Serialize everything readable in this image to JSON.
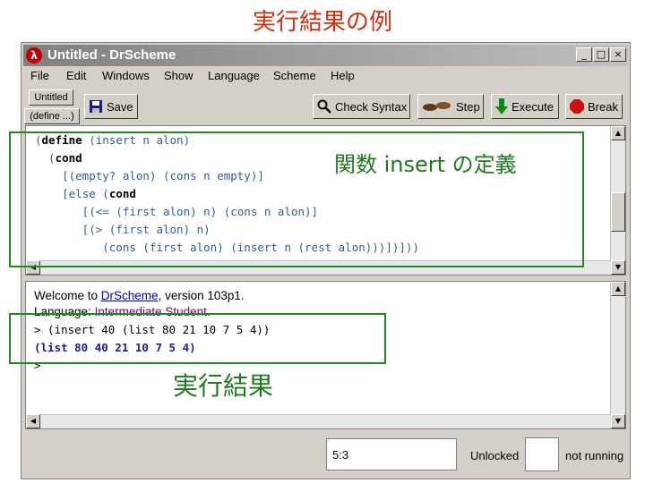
{
  "slide": {
    "title": "実行結果の例"
  },
  "window": {
    "title": "Untitled - DrScheme",
    "icon_letter": "λ",
    "controls": {
      "minimize": "_",
      "maximize": "□",
      "close": "×"
    }
  },
  "menu": [
    "File",
    "Edit",
    "Windows",
    "Show",
    "Language",
    "Scheme",
    "Help"
  ],
  "toolbar": {
    "name_button": "Untitled",
    "define_button": "(define ...)",
    "save": "Save",
    "check_syntax": "Check Syntax",
    "step": "Step",
    "execute": "Execute",
    "break": "Break"
  },
  "definitions": {
    "lines": [
      [
        {
          "t": "(",
          "k": false
        },
        {
          "t": "define",
          "k": true
        },
        {
          "t": " (insert n alon)",
          "k": false
        }
      ],
      [
        {
          "t": "  (",
          "k": false
        },
        {
          "t": "cond",
          "k": true
        }
      ],
      [
        {
          "t": "    [(empty? alon) (cons n empty)]",
          "k": false
        }
      ],
      [
        {
          "t": "    [",
          "k": false
        },
        {
          "t": "else",
          "k": false
        },
        {
          "t": " (",
          "k": false
        },
        {
          "t": "cond",
          "k": true
        }
      ],
      [
        {
          "t": "       [(<= (first alon) n) (cons n alon)]",
          "k": false
        }
      ],
      [
        {
          "t": "       [(> (first alon) n)",
          "k": false
        }
      ],
      [
        {
          "t": "          (cons (first alon) (insert n (rest alon)))])]))",
          "k": false
        }
      ]
    ]
  },
  "interactions": {
    "welcome_prefix": "Welcome to ",
    "welcome_link": "DrScheme",
    "welcome_suffix": ", version 103p1.",
    "language_label": "Language: ",
    "language_value": "Intermediate Student.",
    "input": "> (insert 40 (list 80 21 10 7 5 4))",
    "output": "(list 80 40 21 10 7 5 4)",
    "prompt": ">"
  },
  "status": {
    "position": "5:3",
    "lock": "Unlocked",
    "running": "not running"
  },
  "annotations": {
    "definition": "関数 insert の定義",
    "result": "実行結果"
  },
  "colors": {
    "annotation_green": "#1f8a1f",
    "title_red": "#d03010",
    "code_blue": "#2e5d9f",
    "language_purple": "#800080"
  }
}
